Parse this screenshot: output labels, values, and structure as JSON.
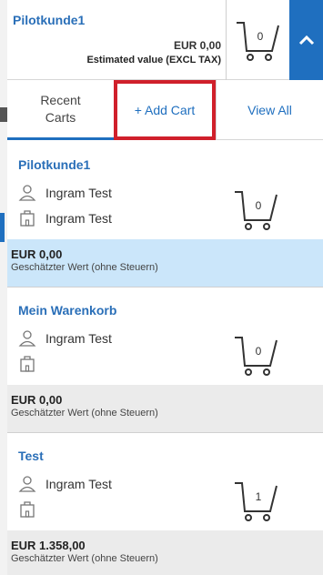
{
  "header": {
    "cart_name": "Pilotkunde1",
    "amount": "EUR 0,00",
    "estimated_label": "Estimated value (EXCL TAX)",
    "cart_count": "0",
    "toggle_icon": "chevron-up-icon"
  },
  "tabs": {
    "recent_label_line1": "Recent",
    "recent_label_line2": "Carts",
    "add_label": "+ Add Cart",
    "view_all_label": "View All"
  },
  "carts": [
    {
      "name": "Pilotkunde1",
      "owner": "Ingram Test",
      "org": "Ingram Test",
      "count": "0",
      "amount": "EUR 0,00",
      "estimated_label": "Geschätzter Wert (ohne Steuern)",
      "active": true
    },
    {
      "name": "Mein Warenkorb",
      "owner": "Ingram Test",
      "org": "",
      "count": "0",
      "amount": "EUR 0,00",
      "estimated_label": "Geschätzter Wert (ohne Steuern)",
      "active": false
    },
    {
      "name": "Test",
      "owner": "Ingram Test",
      "org": "",
      "count": "1",
      "amount": "EUR 1.358,00",
      "estimated_label": "Geschätzter Wert (ohne Steuern)",
      "active": false
    }
  ],
  "colors": {
    "accent": "#1f6fbf",
    "highlight_border": "#d0202b",
    "active_footer": "#cbe6fa"
  }
}
